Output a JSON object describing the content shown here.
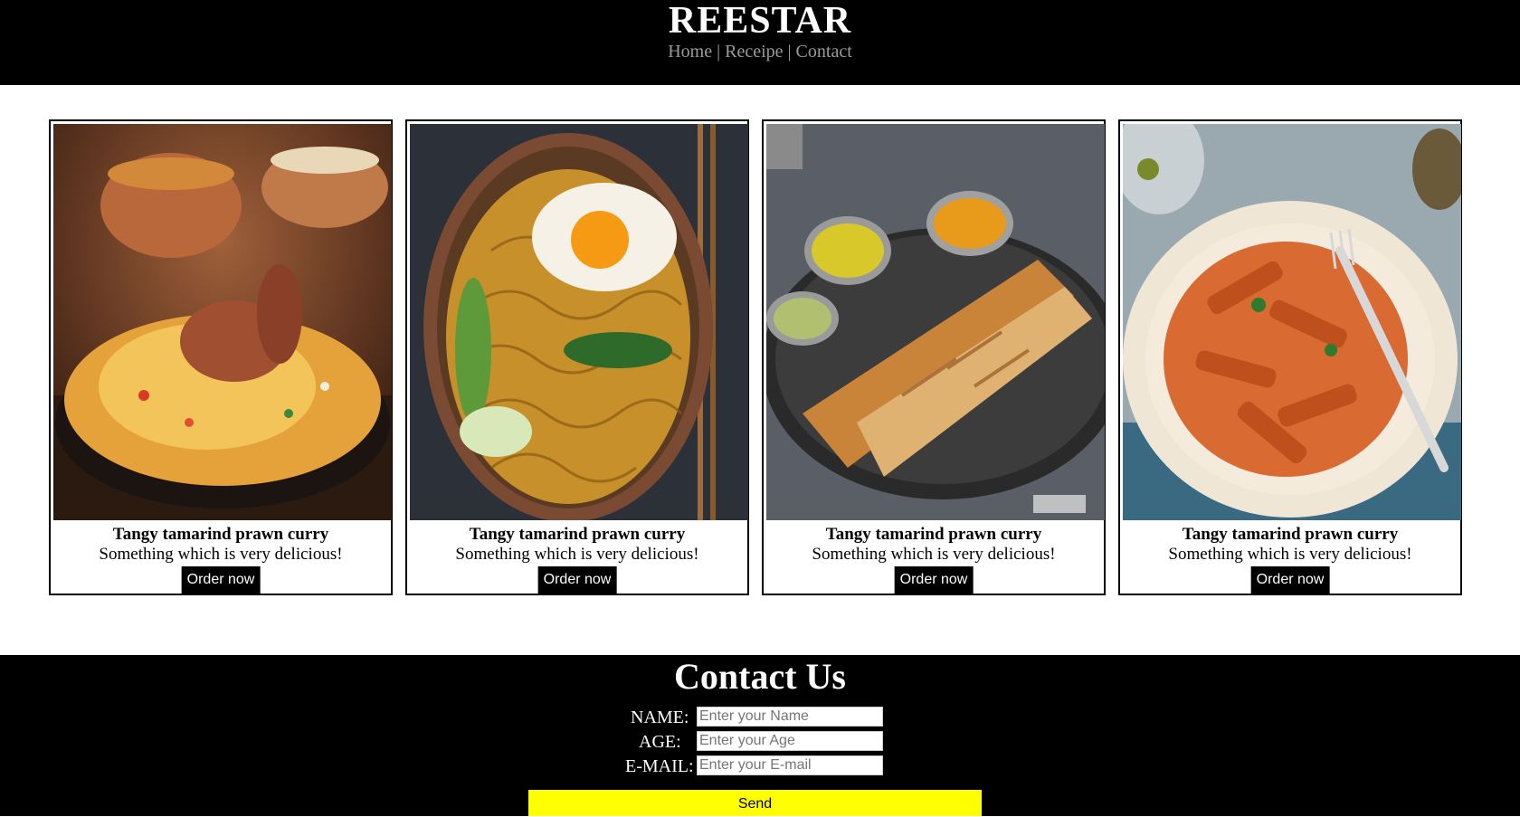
{
  "header": {
    "brand": "REESTAR",
    "nav": [
      {
        "label": "Home"
      },
      {
        "label": "Receipe"
      },
      {
        "label": "Contact"
      }
    ],
    "separator": "|"
  },
  "cards": [
    {
      "image": "biryani-photo",
      "title": "Tangy tamarind prawn curry",
      "description": "Something which is very delicious!",
      "button": "Order now"
    },
    {
      "image": "noodles-egg-photo",
      "title": "Tangy tamarind prawn curry",
      "description": "Something which is very delicious!",
      "button": "Order now"
    },
    {
      "image": "dosa-photo",
      "title": "Tangy tamarind prawn curry",
      "description": "Something which is very delicious!",
      "button": "Order now"
    },
    {
      "image": "penne-pasta-photo",
      "title": "Tangy tamarind prawn curry",
      "description": "Something which is very delicious!",
      "button": "Order now"
    }
  ],
  "contact": {
    "title": "Contact Us",
    "fields": [
      {
        "label": "NAME:",
        "placeholder": "Enter your Name",
        "value": ""
      },
      {
        "label": "AGE:",
        "placeholder": "Enter your Age",
        "value": ""
      },
      {
        "label": "E-MAIL:",
        "placeholder": "Enter your E-mail",
        "value": ""
      }
    ],
    "send_label": "Send"
  },
  "colors": {
    "header_bg": "#000000",
    "nav_text": "#9a9a9a",
    "send_button": "#ffff00"
  }
}
